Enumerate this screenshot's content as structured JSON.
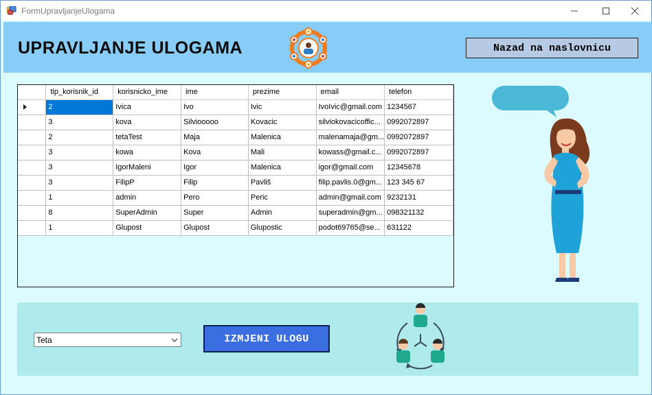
{
  "window": {
    "title": "FormUpravljanjeUlogama",
    "controls": [
      "minimize",
      "maximize",
      "close"
    ]
  },
  "header": {
    "title": "UPRAVLJANJE ULOGAMA",
    "back_button_label": "Nazad na naslovnicu",
    "graphic_icon": "team-network-icon"
  },
  "grid": {
    "columns": [
      "tip_korisnik_id",
      "korisnicko_ime",
      "ime",
      "prezime",
      "email",
      "telefon"
    ],
    "rows": [
      [
        "2",
        "Ivica",
        "Ivo",
        "Ivic",
        "IvoIvic@gmail.com",
        "1234567"
      ],
      [
        "3",
        "kova",
        "Silviooooo",
        "Kovacic",
        "silviokovacicoffic...",
        "0992072897"
      ],
      [
        "2",
        "tetaTest",
        "Maja",
        "Malenica",
        "malenamaja@gm...",
        "0992072897"
      ],
      [
        "3",
        "kowa",
        "Kova",
        "Mali",
        "kowass@gmail.c...",
        "0992072897"
      ],
      [
        "3",
        "IgorMaleni",
        "Igor",
        "Malenica",
        "igor@gmail.com",
        "12345678"
      ],
      [
        "3",
        "FilipP",
        "Filip",
        "Pavliš",
        "filip.pavlis.0@gm...",
        "123 345 67"
      ],
      [
        "1",
        "admin",
        "Pero",
        "Peric",
        "admin@gmail.com",
        "9232131"
      ],
      [
        "8",
        "SuperAdmin",
        "Super",
        "Admin",
        "superadmin@gm...",
        "098321132"
      ],
      [
        "1",
        "Glupost",
        "Glupost",
        "Glupostic",
        "podot69765@se...",
        "631122"
      ]
    ],
    "selected_row": 0
  },
  "bottom": {
    "role_select_value": "Teta",
    "change_button_label": "IZMJENI ULOGU",
    "graphic_icon": "people-cycle-icon"
  },
  "colors": {
    "header_bg": "#87cdf7",
    "window_bg": "#dcfbfe",
    "bottom_panel_bg": "#afebec",
    "accent_button": "#3b6ee0",
    "back_button_bg": "#b6cbe3",
    "selection": "#0078d7"
  }
}
